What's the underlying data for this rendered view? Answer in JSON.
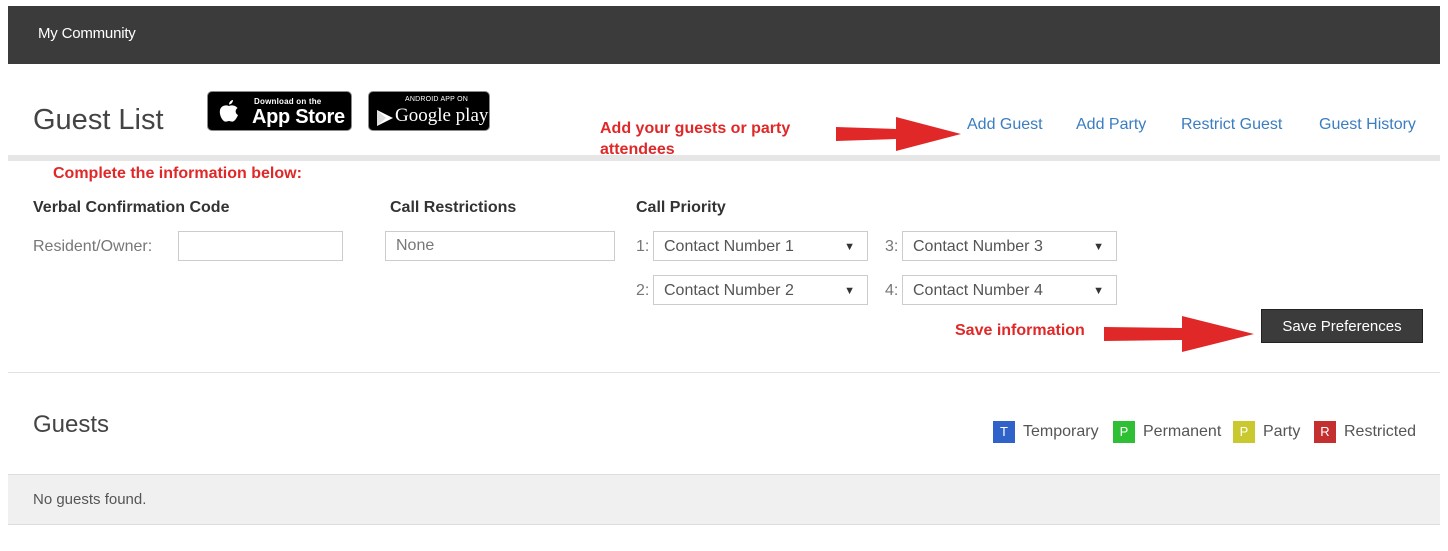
{
  "header": {
    "brand": "My Community"
  },
  "page": {
    "title": "Guest List"
  },
  "badges": {
    "appstore": {
      "small": "Download on the",
      "big": "App Store"
    },
    "googleplay": {
      "small": "ANDROID APP ON",
      "big": "Google play"
    }
  },
  "annotations": {
    "add_guests": "Add your guests or party attendees",
    "complete_info": "Complete the information below:",
    "save_info": "Save information",
    "color": "#e02828"
  },
  "nav": {
    "links": [
      "Add Guest",
      "Add Party",
      "Restrict Guest",
      "Guest History"
    ],
    "link_color": "#3a7dc0"
  },
  "form": {
    "verbal": {
      "heading": "Verbal Confirmation Code",
      "label": "Resident/Owner:",
      "value": ""
    },
    "restrictions": {
      "heading": "Call Restrictions",
      "value": "None"
    },
    "priority": {
      "heading": "Call Priority",
      "items": [
        {
          "num": "1:",
          "value": "Contact Number 1"
        },
        {
          "num": "2:",
          "value": "Contact Number 2"
        },
        {
          "num": "3:",
          "value": "Contact Number 3"
        },
        {
          "num": "4:",
          "value": "Contact Number 4"
        }
      ]
    },
    "save_label": "Save Preferences"
  },
  "guests": {
    "title": "Guests",
    "empty_text": "No guests found.",
    "legend": [
      {
        "letter": "T",
        "label": "Temporary",
        "color": "#2f63c9"
      },
      {
        "letter": "P",
        "label": "Permanent",
        "color": "#2fbf35"
      },
      {
        "letter": "P",
        "label": "Party",
        "color": "#c9c92f"
      },
      {
        "letter": "R",
        "label": "Restricted",
        "color": "#c43030"
      }
    ]
  },
  "icons": {
    "apple": "apple-icon",
    "play": "google-play-icon",
    "caret": "chevron-down-icon",
    "arrow": "red-arrow-icon"
  }
}
